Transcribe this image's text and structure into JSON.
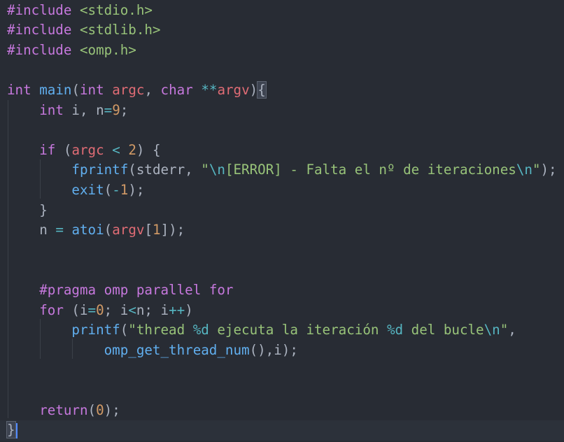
{
  "editor": {
    "lines": [
      [
        {
          "t": "#include ",
          "c": "preproc"
        },
        {
          "t": "<stdio.h>",
          "c": "header"
        }
      ],
      [
        {
          "t": "#include ",
          "c": "preproc"
        },
        {
          "t": "<stdlib.h>",
          "c": "header"
        }
      ],
      [
        {
          "t": "#include ",
          "c": "preproc"
        },
        {
          "t": "<omp.h>",
          "c": "header"
        }
      ],
      [],
      [
        {
          "t": "int",
          "c": "type"
        },
        {
          "t": " ",
          "c": "plain"
        },
        {
          "t": "main",
          "c": "fn"
        },
        {
          "t": "(",
          "c": "plain"
        },
        {
          "t": "int",
          "c": "type"
        },
        {
          "t": " ",
          "c": "plain"
        },
        {
          "t": "argc",
          "c": "param"
        },
        {
          "t": ", ",
          "c": "plain"
        },
        {
          "t": "char",
          "c": "type"
        },
        {
          "t": " ",
          "c": "plain"
        },
        {
          "t": "**",
          "c": "op"
        },
        {
          "t": "argv",
          "c": "param"
        },
        {
          "t": ")",
          "c": "plain"
        },
        {
          "t": "{",
          "c": "brace-hl"
        }
      ],
      [
        {
          "t": "    ",
          "c": "plain"
        },
        {
          "t": "int",
          "c": "type"
        },
        {
          "t": " i, n",
          "c": "plain"
        },
        {
          "t": "=",
          "c": "op"
        },
        {
          "t": "9",
          "c": "num"
        },
        {
          "t": ";",
          "c": "plain"
        }
      ],
      [],
      [
        {
          "t": "    ",
          "c": "plain"
        },
        {
          "t": "if",
          "c": "kw"
        },
        {
          "t": " (",
          "c": "plain"
        },
        {
          "t": "argc",
          "c": "param"
        },
        {
          "t": " ",
          "c": "plain"
        },
        {
          "t": "<",
          "c": "op"
        },
        {
          "t": " ",
          "c": "plain"
        },
        {
          "t": "2",
          "c": "num"
        },
        {
          "t": ") {",
          "c": "plain"
        }
      ],
      [
        {
          "t": "        ",
          "c": "plain"
        },
        {
          "t": "fprintf",
          "c": "fn"
        },
        {
          "t": "(stderr, ",
          "c": "plain"
        },
        {
          "t": "\"",
          "c": "str"
        },
        {
          "t": "\\n",
          "c": "esc"
        },
        {
          "t": "[ERROR] - Falta el nº de iteraciones",
          "c": "str"
        },
        {
          "t": "\\n",
          "c": "esc"
        },
        {
          "t": "\"",
          "c": "str"
        },
        {
          "t": ");",
          "c": "plain"
        }
      ],
      [
        {
          "t": "        ",
          "c": "plain"
        },
        {
          "t": "exit",
          "c": "fn"
        },
        {
          "t": "(",
          "c": "plain"
        },
        {
          "t": "-",
          "c": "op"
        },
        {
          "t": "1",
          "c": "num"
        },
        {
          "t": ");",
          "c": "plain"
        }
      ],
      [
        {
          "t": "    }",
          "c": "plain"
        }
      ],
      [
        {
          "t": "    n ",
          "c": "plain"
        },
        {
          "t": "=",
          "c": "op"
        },
        {
          "t": " ",
          "c": "plain"
        },
        {
          "t": "atoi",
          "c": "fn"
        },
        {
          "t": "(",
          "c": "plain"
        },
        {
          "t": "argv",
          "c": "param"
        },
        {
          "t": "[",
          "c": "plain"
        },
        {
          "t": "1",
          "c": "num"
        },
        {
          "t": "]);",
          "c": "plain"
        }
      ],
      [],
      [],
      [
        {
          "t": "    ",
          "c": "plain"
        },
        {
          "t": "#pragma",
          "c": "preproc"
        },
        {
          "t": " omp parallel for",
          "c": "kw"
        }
      ],
      [
        {
          "t": "    ",
          "c": "plain"
        },
        {
          "t": "for",
          "c": "kw"
        },
        {
          "t": " (i",
          "c": "plain"
        },
        {
          "t": "=",
          "c": "op"
        },
        {
          "t": "0",
          "c": "num"
        },
        {
          "t": "; i",
          "c": "plain"
        },
        {
          "t": "<",
          "c": "op"
        },
        {
          "t": "n; i",
          "c": "plain"
        },
        {
          "t": "++",
          "c": "op"
        },
        {
          "t": ")",
          "c": "plain"
        }
      ],
      [
        {
          "t": "        ",
          "c": "plain"
        },
        {
          "t": "printf",
          "c": "fn"
        },
        {
          "t": "(",
          "c": "plain"
        },
        {
          "t": "\"thread ",
          "c": "str"
        },
        {
          "t": "%d",
          "c": "esc"
        },
        {
          "t": " ejecuta la iteración ",
          "c": "str"
        },
        {
          "t": "%d",
          "c": "esc"
        },
        {
          "t": " del bucle",
          "c": "str"
        },
        {
          "t": "\\n",
          "c": "esc"
        },
        {
          "t": "\"",
          "c": "str"
        },
        {
          "t": ",",
          "c": "plain"
        }
      ],
      [
        {
          "t": "            ",
          "c": "plain"
        },
        {
          "t": "omp_get_thread_num",
          "c": "fn"
        },
        {
          "t": "(),i);",
          "c": "plain"
        }
      ],
      [],
      [],
      [
        {
          "t": "    ",
          "c": "plain"
        },
        {
          "t": "return",
          "c": "kw"
        },
        {
          "t": "(",
          "c": "plain"
        },
        {
          "t": "0",
          "c": "num"
        },
        {
          "t": ");",
          "c": "plain"
        }
      ],
      [
        {
          "t": "}",
          "c": "brace-hl"
        }
      ]
    ],
    "current_line_index": 21,
    "colors": {
      "background": "#282c34",
      "current_line": "#2c313a",
      "keyword": "#c678dd",
      "function": "#61afef",
      "string": "#98c379",
      "number": "#d19a66",
      "parameter": "#e06c75",
      "operator": "#56b6c2",
      "plain": "#abb2bf"
    }
  }
}
